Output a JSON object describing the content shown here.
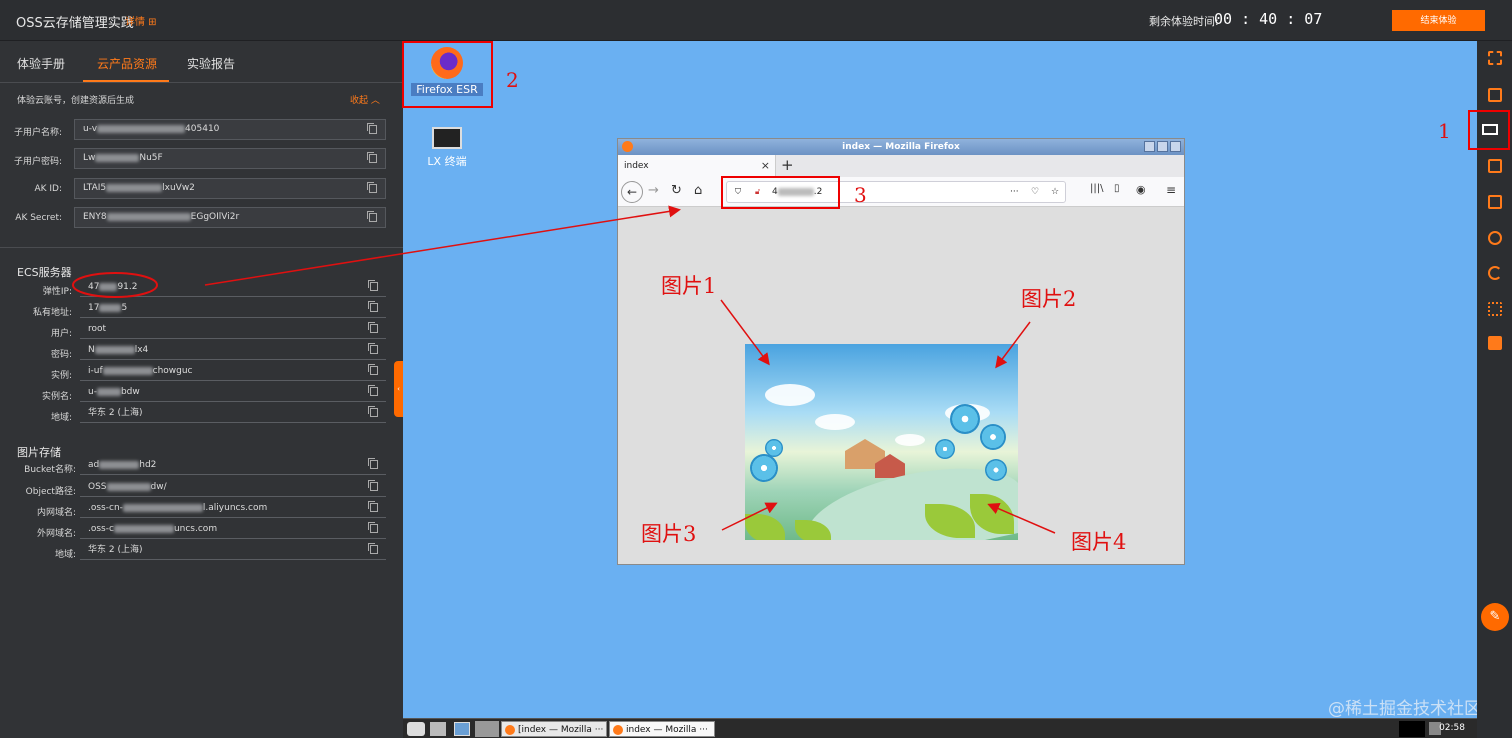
{
  "topbar": {
    "title": "OSS云存储管理实践",
    "detail_link": "详情",
    "timer_label": "剩余体验时间:",
    "timer_value": "00 : 40 : 07",
    "end_button": "结束体验"
  },
  "left_panel": {
    "tabs": [
      "体验手册",
      "云产品资源",
      "实验报告"
    ],
    "account_note": "体验云账号，创建资源后生成",
    "collapse_label": "收起",
    "account_fields": [
      {
        "label": "子用户名称:",
        "prefix": "u-v",
        "suffix": "405410"
      },
      {
        "label": "子用户密码:",
        "prefix": "Lw",
        "suffix": "Nu5F"
      },
      {
        "label": "AK ID:",
        "prefix": "LTAI5",
        "suffix": "lxuVw2"
      },
      {
        "label": "AK Secret:",
        "prefix": "ENY8",
        "suffix": "EGgOIlVi2r"
      }
    ],
    "ecs_title": "ECS服务器",
    "ecs_fields": [
      {
        "label": "弹性IP:",
        "prefix": "47",
        "suffix": "91.2"
      },
      {
        "label": "私有地址:",
        "prefix": "17",
        "suffix": "5"
      },
      {
        "label": "用户:",
        "prefix": "root",
        "suffix": ""
      },
      {
        "label": "密码:",
        "prefix": "N",
        "suffix": "lx4"
      },
      {
        "label": "实例:",
        "prefix": "i-uf",
        "suffix": "chowguc"
      },
      {
        "label": "实例名:",
        "prefix": "u-",
        "suffix": "bdw"
      },
      {
        "label": "地域:",
        "prefix": "华东 2 (上海)",
        "suffix": ""
      }
    ],
    "storage_title": "图片存储",
    "storage_fields": [
      {
        "label": "Bucket名称:",
        "prefix": "ad",
        "suffix": "hd2"
      },
      {
        "label": "Object路径:",
        "prefix": "OSS",
        "suffix": "dw/"
      },
      {
        "label": "内网域名:",
        "prefix": ".oss-cn-",
        "suffix": "l.aliyuncs.com"
      },
      {
        "label": "外网域名:",
        "prefix": ".oss-c",
        "suffix": "uncs.com"
      },
      {
        "label": "地域:",
        "prefix": "华东 2 (上海)",
        "suffix": ""
      }
    ]
  },
  "desktop": {
    "icons": [
      {
        "label": "Firefox ESR"
      },
      {
        "label": "LX 终端"
      }
    ],
    "annotations": [
      "1",
      "2",
      "3",
      "图片1",
      "图片2",
      "图片3",
      "图片4"
    ],
    "annotation_color": "#e01010"
  },
  "firefox": {
    "window_title": "index — Mozilla Firefox",
    "tab_title": "index",
    "tab_close": "×",
    "new_tab": "+",
    "url_prefix": "4",
    "url_suffix": ".2"
  },
  "taskbar": {
    "items": [
      "[index — Mozilla ···",
      "index — Mozilla ···"
    ],
    "clock": "02:58"
  },
  "watermark": "@稀土掘金技术社区",
  "colors": {
    "accent": "#ff6a00",
    "desktop_bg": "#6ab0f2",
    "panel_bg": "#313336"
  }
}
